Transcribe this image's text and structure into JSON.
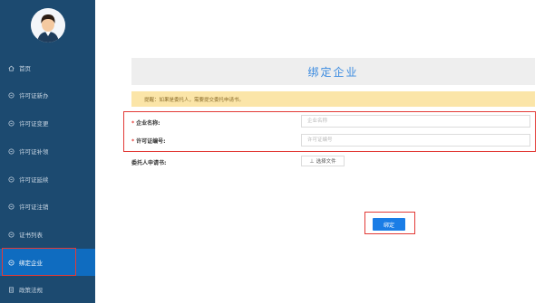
{
  "sidebar": {
    "items": [
      {
        "label": "首页",
        "icon": "home-icon",
        "active": false
      },
      {
        "label": "许可证新办",
        "icon": "circle-icon",
        "active": false
      },
      {
        "label": "许可证变更",
        "icon": "circle-icon",
        "active": false
      },
      {
        "label": "许可证补领",
        "icon": "circle-icon",
        "active": false
      },
      {
        "label": "许可证延续",
        "icon": "circle-icon",
        "active": false
      },
      {
        "label": "许可证注销",
        "icon": "circle-icon",
        "active": false
      },
      {
        "label": "证书列表",
        "icon": "circle-icon",
        "active": false
      },
      {
        "label": "绑定企业",
        "icon": "circle-icon",
        "active": true
      },
      {
        "label": "政策法规",
        "icon": "document-icon",
        "active": false
      }
    ]
  },
  "main": {
    "title": "绑定企业",
    "notice": "提醒：如果是委托人，需要提交委托申请书。",
    "fields": {
      "company_name": {
        "label": "企业名称:",
        "required_mark": "*",
        "placeholder": "企业名称",
        "value": ""
      },
      "license_no": {
        "label": "许可证编号:",
        "required_mark": "*",
        "placeholder": "许可证编号",
        "value": ""
      },
      "authorization": {
        "label": "委托人申请书:",
        "button_label": "选择文件"
      }
    },
    "bind_button": "绑定"
  },
  "colors": {
    "sidebar_bg": "#1c4a70",
    "active_item": "#0f6cc0",
    "title_text": "#3b8be0",
    "notice_bg": "#fbe5a8",
    "highlight_red": "#e23a36",
    "primary_button": "#1a7de6"
  }
}
